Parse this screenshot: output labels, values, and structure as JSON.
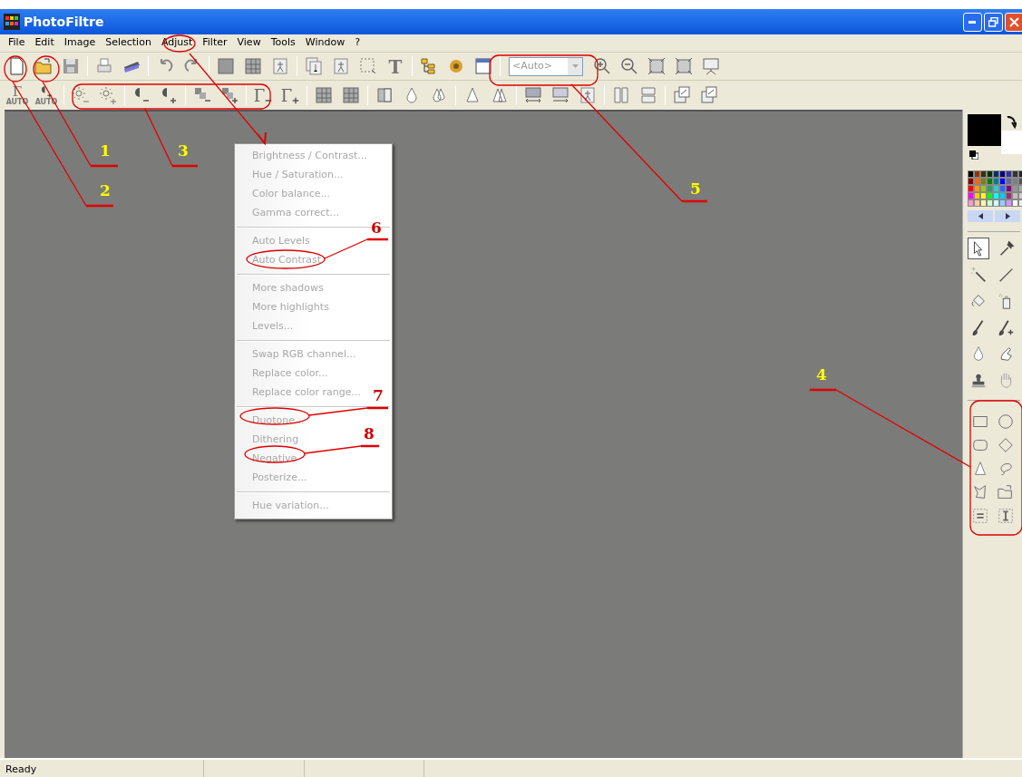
{
  "window": {
    "title": "PhotoFiltre"
  },
  "menu_bar": [
    "File",
    "Edit",
    "Image",
    "Selection",
    "Adjust",
    "Filter",
    "View",
    "Tools",
    "Window",
    "?"
  ],
  "toolbar_1": {
    "text_tool": "T",
    "zoom_combo": {
      "value": "<Auto>",
      "disabled": true
    }
  },
  "toolbar_2": {
    "auto_buttons": [
      {
        "glyph": "Γ",
        "caption": "AUTO"
      },
      {
        "caption": "AUTO"
      }
    ],
    "gamma_buttons": [
      "Γ",
      "Γ"
    ]
  },
  "adjust_menu": {
    "groups": [
      [
        {
          "label": "Brightness / Contrast...",
          "disabled": true
        },
        {
          "label": "Hue / Saturation...",
          "disabled": true
        },
        {
          "label": "Color balance...",
          "disabled": true
        },
        {
          "label": "Gamma correct...",
          "disabled": true
        }
      ],
      [
        {
          "label": "Auto Levels",
          "disabled": true
        },
        {
          "label": "Auto Contrast",
          "disabled": true
        }
      ],
      [
        {
          "label": "More shadows",
          "disabled": true
        },
        {
          "label": "More highlights",
          "disabled": true
        },
        {
          "label": "Levels...",
          "disabled": true
        }
      ],
      [
        {
          "label": "Swap RGB channel...",
          "disabled": true
        },
        {
          "label": "Replace color...",
          "disabled": true
        },
        {
          "label": "Replace color range...",
          "disabled": true
        }
      ],
      [
        {
          "label": "Duotone...",
          "disabled": true
        },
        {
          "label": "Dithering",
          "disabled": true
        },
        {
          "label": "Negative",
          "disabled": true
        },
        {
          "label": "Posterize...",
          "disabled": true
        }
      ],
      [
        {
          "label": "Hue variation...",
          "disabled": true
        }
      ]
    ]
  },
  "annotations": [
    {
      "label": "1",
      "color": "#ffff00"
    },
    {
      "label": "2",
      "color": "#ffff00"
    },
    {
      "label": "3",
      "color": "#ffff00"
    },
    {
      "label": "5",
      "color": "#ffff00"
    },
    {
      "label": "4",
      "color": "#ffff00"
    },
    {
      "label": "6",
      "color": "#cc0000"
    },
    {
      "label": "7",
      "color": "#cc0000"
    },
    {
      "label": "8",
      "color": "#cc0000"
    }
  ],
  "status_bar": {
    "text": "Ready"
  }
}
